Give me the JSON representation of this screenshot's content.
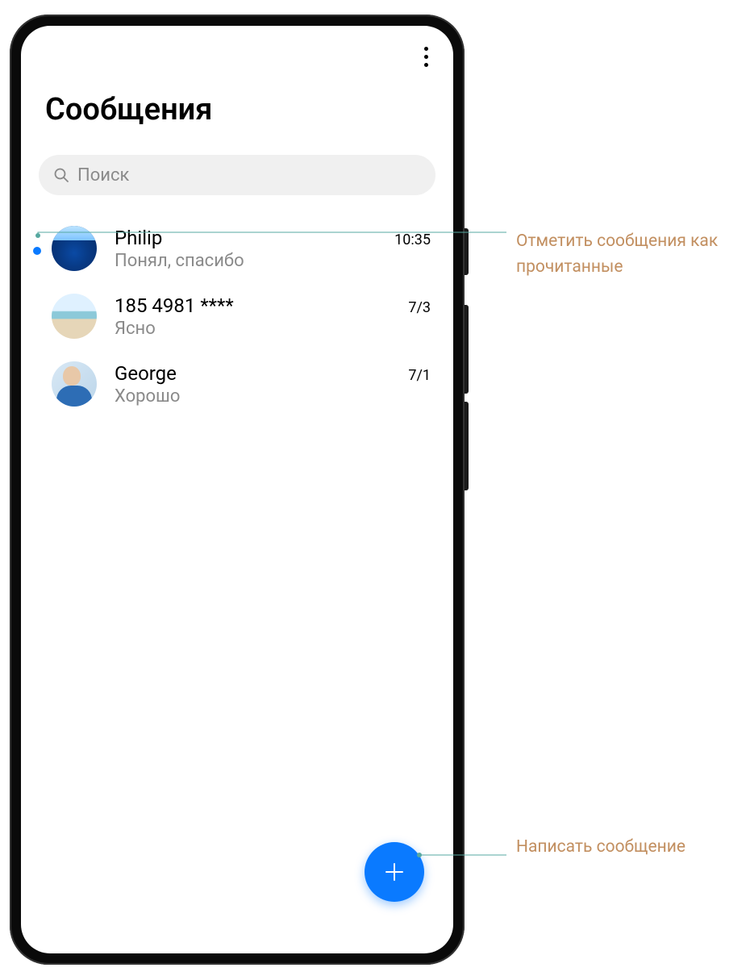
{
  "app": {
    "title": "Сообщения"
  },
  "search": {
    "placeholder": "Поиск"
  },
  "conversations": [
    {
      "name": "Philip",
      "preview": "Понял, спасибо",
      "time": "10:35",
      "unread": true,
      "avatar": "ocean"
    },
    {
      "name": "185 4981 ****",
      "preview": "Ясно",
      "time": "7/3",
      "unread": false,
      "avatar": "beach"
    },
    {
      "name": "George",
      "preview": "Хорошо",
      "time": "7/1",
      "unread": false,
      "avatar": "person"
    }
  ],
  "callouts": {
    "mark_read": "Отметить сообщения как прочитанные",
    "compose": "Написать сообщение"
  },
  "colors": {
    "accent": "#0a7aff",
    "callout_text": "#c28f60",
    "lead_line": "#56a8a0"
  }
}
